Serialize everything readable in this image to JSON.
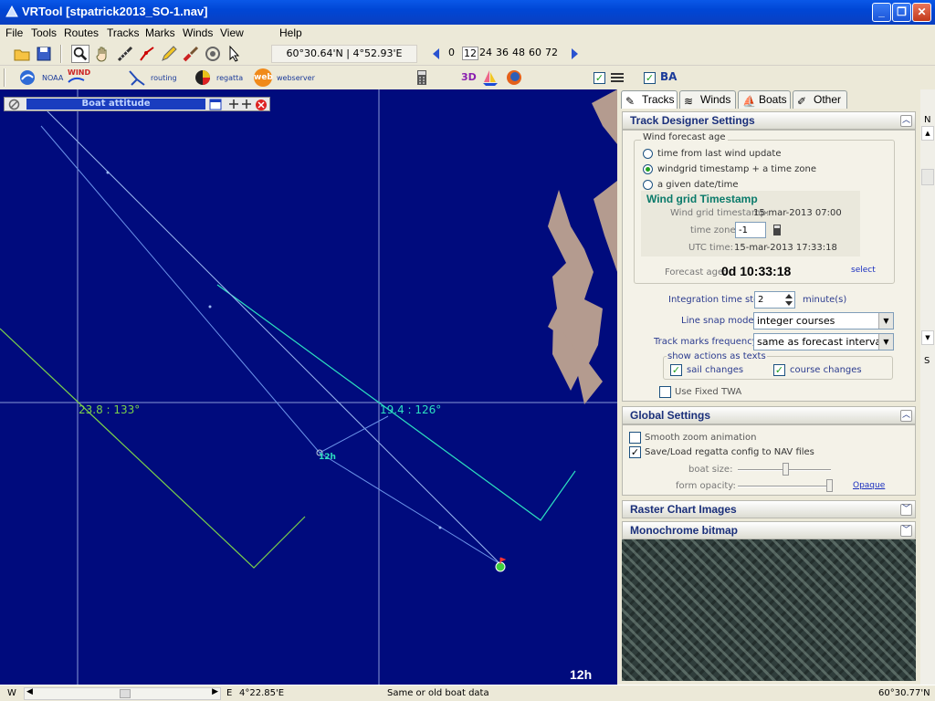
{
  "window": {
    "title": "VRTool [stpatrick2013_SO-1.nav]"
  },
  "menu": [
    "File",
    "Tools",
    "Routes",
    "Tracks",
    "Marks",
    "Winds",
    "View",
    "Help"
  ],
  "toolbar": {
    "coords": "60°30.64'N | 4°52.93'E",
    "hours": [
      "0",
      "12",
      "24",
      "36",
      "48",
      "60",
      "72"
    ],
    "selected_hour": "12",
    "noaa_label": "NOAA",
    "wind_label": "WIND",
    "routing_label": "routing",
    "regatta_label": "regatta",
    "web_label": "web",
    "webserver_label": "webserver",
    "three_d_label": "3D",
    "ba_label": "BA"
  },
  "map": {
    "panel_title": "Boat attitude",
    "label_left": "23.8 : 133°",
    "label_right": "19.4 : 126°",
    "marker_label": "12h",
    "corner_label": "12h"
  },
  "tabs": [
    "Tracks",
    "Winds",
    "Boats",
    "Other"
  ],
  "track_designer": {
    "header": "Track Designer Settings",
    "wind_forecast_age": "Wind forecast age",
    "opt1": "time from last wind update",
    "opt2": "windgrid timestamp + a time zone",
    "opt3": "a given date/time",
    "grid_title": "Wind grid Timestamp",
    "grid_ts_label": "Wind grid timestamp:",
    "grid_ts_value": "15-mar-2013 07:00",
    "tz_label": "time zone:",
    "tz_value": "-1",
    "utc_label": "UTC time:",
    "utc_value": "15-mar-2013 17:33:18",
    "forecast_age_label": "Forecast age:",
    "forecast_age_value": "0d 10:33:18",
    "select_link": "select",
    "integration_label": "Integration time step:",
    "integration_value": "2",
    "integration_unit": "minute(s)",
    "snap_label": "Line snap mode:",
    "snap_value": "integer courses",
    "marks_label": "Track marks frequency:",
    "marks_value": "same as forecast intervals",
    "show_actions": "show actions as texts",
    "sail_changes": "sail changes",
    "course_changes": "course changes",
    "fixed_twa": "Use Fixed TWA"
  },
  "global": {
    "header": "Global Settings",
    "smooth_zoom": "Smooth zoom animation",
    "save_load": "Save/Load regatta config to NAV files",
    "boat_size": "boat size:",
    "form_opacity": "form opacity:",
    "opaque_link": "Opaque"
  },
  "raster": {
    "header": "Raster Chart Images"
  },
  "mono": {
    "header": "Monochrome bitmap"
  },
  "scroll": {
    "n": "N",
    "s": "S"
  },
  "status": {
    "w": "W",
    "e": "E",
    "lon": "4°22.85'E",
    "msg": "Same or old boat data",
    "lat": "60°30.77'N"
  }
}
